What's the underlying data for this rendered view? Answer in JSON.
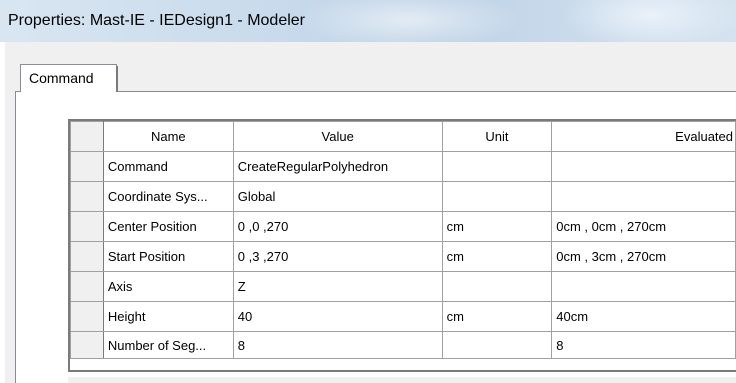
{
  "window": {
    "title": "Properties: Mast-IE - IEDesign1 - Modeler"
  },
  "tabs": [
    {
      "label": "Command",
      "selected": true
    }
  ],
  "grid": {
    "columns": [
      "Name",
      "Value",
      "Unit",
      "Evaluated"
    ],
    "rows": [
      {
        "name": "Command",
        "value": "CreateRegularPolyhedron",
        "unit": "",
        "evaluated": ""
      },
      {
        "name": "Coordinate Sys...",
        "value": "Global",
        "unit": "",
        "evaluated": ""
      },
      {
        "name": "Center Position",
        "value": "0 ,0 ,270",
        "unit": "cm",
        "evaluated": "0cm , 0cm , 270cm"
      },
      {
        "name": "Start Position",
        "value": "0 ,3 ,270",
        "unit": "cm",
        "evaluated": "0cm , 3cm , 270cm"
      },
      {
        "name": "Axis",
        "value": "Z",
        "unit": "",
        "evaluated": ""
      },
      {
        "name": "Height",
        "value": "40",
        "unit": "cm",
        "evaluated": "40cm"
      },
      {
        "name": "Number of Seg...",
        "value": "8",
        "unit": "",
        "evaluated": "8"
      }
    ]
  }
}
